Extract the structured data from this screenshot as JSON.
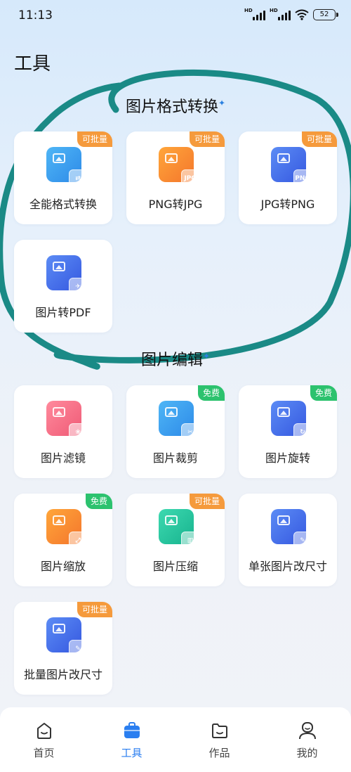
{
  "status": {
    "time": "11:13",
    "battery": "52",
    "hd1": "HD",
    "hd2": "HD"
  },
  "page_title": "工具",
  "sections": [
    {
      "title": "图片格式转换"
    },
    {
      "title": "图片编辑"
    }
  ],
  "cards": [
    {
      "label": "全能格式转换",
      "badge": "可批量",
      "sub_text": ""
    },
    {
      "label": "PNG转JPG",
      "badge": "可批量",
      "sub_text": "JPG"
    },
    {
      "label": "JPG转PNG",
      "badge": "可批量",
      "sub_text": "PNG"
    },
    {
      "label": "图片转PDF",
      "badge": "",
      "sub_text": ""
    },
    {
      "label": "图片滤镜",
      "badge": "",
      "sub_text": ""
    },
    {
      "label": "图片裁剪",
      "badge": "免费",
      "sub_text": ""
    },
    {
      "label": "图片旋转",
      "badge": "免费",
      "sub_text": ""
    },
    {
      "label": "图片缩放",
      "badge": "免费",
      "sub_text": ""
    },
    {
      "label": "图片压缩",
      "badge": "可批量",
      "sub_text": ""
    },
    {
      "label": "单张图片改尺寸",
      "badge": "",
      "sub_text": ""
    },
    {
      "label": "批量图片改尺寸",
      "badge": "可批量",
      "sub_text": ""
    }
  ],
  "nav": [
    {
      "label": "首页",
      "icon": "home-icon"
    },
    {
      "label": "工具",
      "icon": "toolbox-icon",
      "active": true
    },
    {
      "label": "作品",
      "icon": "folder-icon"
    },
    {
      "label": "我的",
      "icon": "profile-icon"
    }
  ],
  "colors": {
    "accent": "#2a7ef0",
    "badge_orange": "#f59a3c",
    "badge_green": "#2cc26e",
    "annotation": "#1a8a86"
  }
}
